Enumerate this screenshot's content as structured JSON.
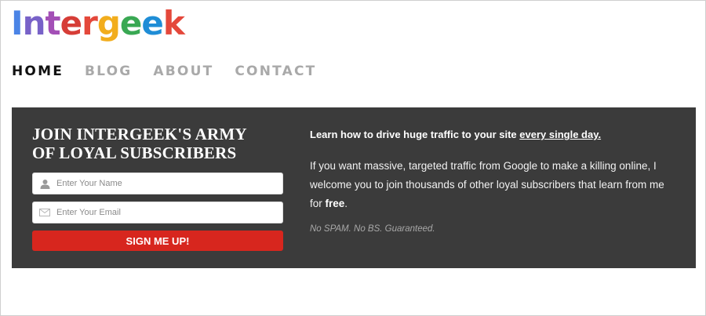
{
  "logo": {
    "letters": [
      {
        "char": "I",
        "color": "#4b84e6"
      },
      {
        "char": "n",
        "color": "#7862c8"
      },
      {
        "char": "t",
        "color": "#a34fb6"
      },
      {
        "char": "e",
        "color": "#d63d37"
      },
      {
        "char": "r",
        "color": "#e4483b"
      },
      {
        "char": "g",
        "color": "#f2ad1d"
      },
      {
        "char": "e",
        "color": "#39a853"
      },
      {
        "char": "e",
        "color": "#1f8dd6"
      },
      {
        "char": "k",
        "color": "#e4483b"
      }
    ]
  },
  "nav": {
    "items": [
      {
        "label": "HOME",
        "active": true
      },
      {
        "label": "BLOG",
        "active": false
      },
      {
        "label": "ABOUT",
        "active": false
      },
      {
        "label": "CONTACT",
        "active": false
      }
    ]
  },
  "signup": {
    "title": "JOIN INTERGEEK'S ARMY OF LOYAL SUBSCRIBERS",
    "name_placeholder": "Enter Your Name",
    "email_placeholder": "Enter Your Email",
    "button_label": "SIGN ME UP!"
  },
  "pitch": {
    "lead_prefix": "Learn how to drive huge traffic to your site ",
    "lead_link": "every single day.",
    "body_prefix": "If you want massive, targeted traffic from Google to make a killing online, I welcome you to join thousands of other loyal subscribers that learn from me for ",
    "body_bold": "free",
    "body_suffix": ".",
    "disclaimer": "No SPAM. No BS. Guaranteed."
  },
  "colors": {
    "panel_bg": "#3b3b3b",
    "button_bg": "#d7261e",
    "nav_active": "#111111",
    "nav_inactive": "#a9a9a9"
  }
}
